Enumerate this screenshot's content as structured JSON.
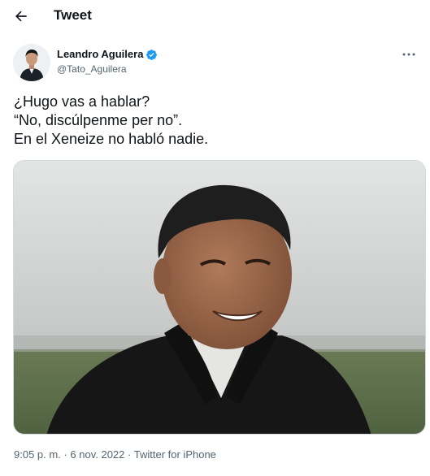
{
  "header": {
    "back_icon": "arrow-left-icon",
    "title": "Tweet"
  },
  "author": {
    "display_name": "Leandro Aguilera",
    "handle": "@Tato_Aguilera",
    "verified_icon": "verified-badge-icon",
    "more_icon": "more-horizontal-icon"
  },
  "tweet": {
    "lines": [
      "¿Hugo vas a hablar?",
      "“No, discúlpenme per no”.",
      "En el Xeneize no habló nadie."
    ]
  },
  "meta": {
    "time": "9:05 p. m.",
    "separator": "·",
    "date": "6 nov. 2022",
    "source": "Twitter for iPhone"
  },
  "colors": {
    "accent": "#1d9bf0",
    "text_primary": "#0f1419",
    "text_secondary": "#536471"
  }
}
